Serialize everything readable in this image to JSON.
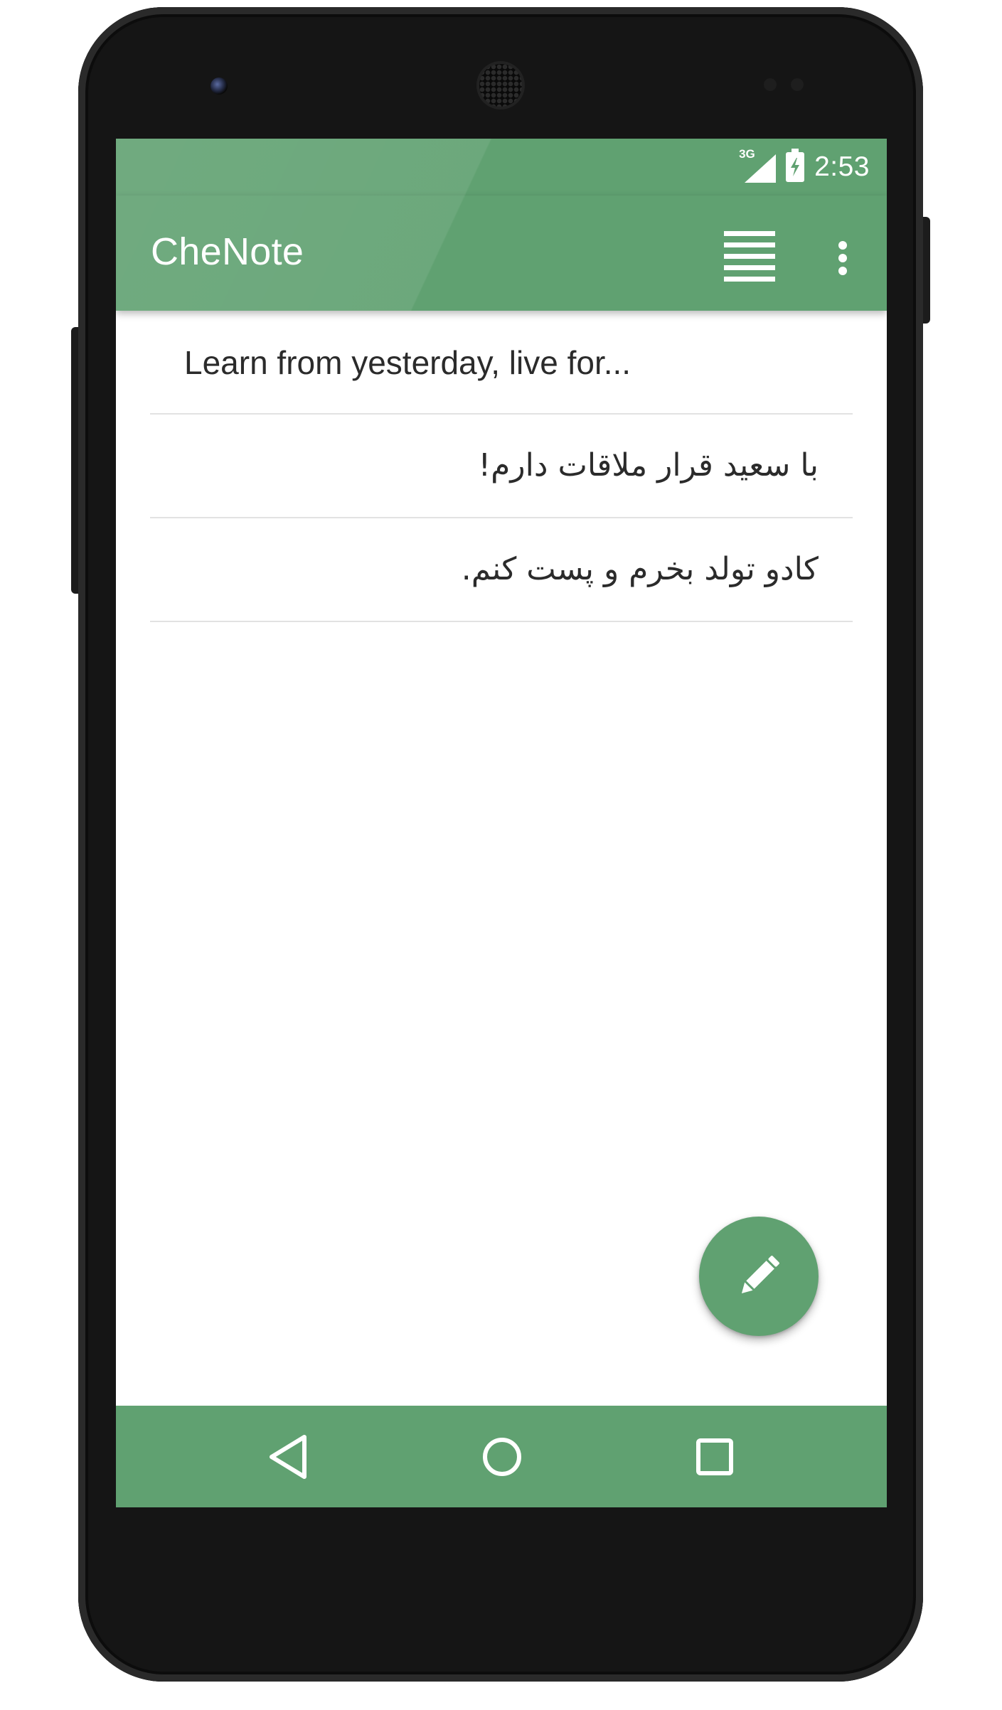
{
  "status_bar": {
    "network_label": "3G",
    "time": "2:53",
    "icons": [
      "signal-icon",
      "battery-charging-icon"
    ]
  },
  "app_bar": {
    "title": "CheNote",
    "icons": [
      "list-view-icon",
      "more-vertical-icon"
    ]
  },
  "notes": [
    {
      "text": "Learn from yesterday, live for...",
      "direction": "ltr"
    },
    {
      "text": "با سعید قرار ملاقات دارم!",
      "direction": "rtl"
    },
    {
      "text": "کادو تولد بخرم و پست کنم.",
      "direction": "rtl"
    }
  ],
  "fab": {
    "icon": "pencil-icon"
  },
  "nav_bar": {
    "icons": [
      "back-icon",
      "home-icon",
      "recents-icon"
    ]
  },
  "colors": {
    "primary": "#60a171",
    "divider": "#e2e2e2",
    "text": "#2b2b2b",
    "device_body": "#151515"
  }
}
